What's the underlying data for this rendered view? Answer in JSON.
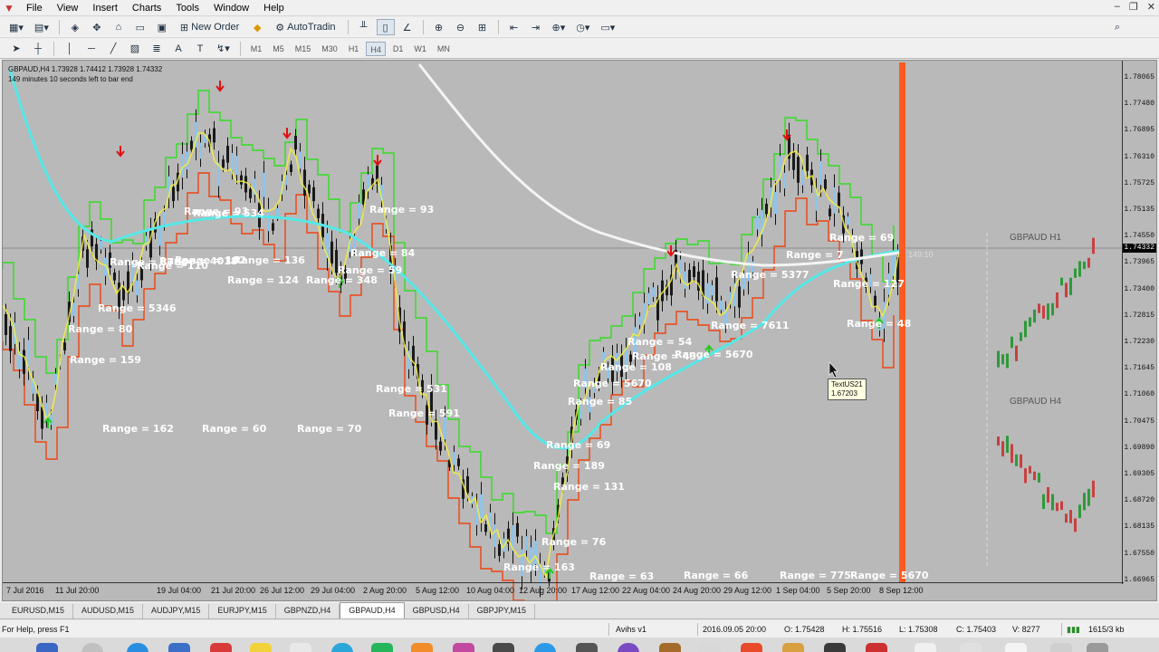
{
  "menu": {
    "items": [
      "File",
      "View",
      "Insert",
      "Charts",
      "Tools",
      "Window",
      "Help"
    ]
  },
  "toolbar": {
    "new_order": "New Order",
    "autotrading": "AutoTradin",
    "timeframes": [
      "M1",
      "M5",
      "M15",
      "M30",
      "H1",
      "H4",
      "D1",
      "W1",
      "MN"
    ],
    "active_timeframe": "H4"
  },
  "chart": {
    "header_line1": "GBPAUD,H4  1.73928 1.74412 1.73928 1.74332",
    "header_line2": "149 minutes 10 seconds left to bar end",
    "current_price": "1.74332",
    "price_ticks": [
      "1.78065",
      "1.77480",
      "1.76895",
      "1.76310",
      "1.75725",
      "1.75135",
      "1.74550",
      "1.73965",
      "1.73400",
      "1.72815",
      "1.72230",
      "1.71645",
      "1.71060",
      "1.70475",
      "1.69890",
      "1.69305",
      "1.68720",
      "1.68135",
      "1.67550",
      "1.66965"
    ],
    "time_ticks": [
      "7 Jul 2016",
      "11 Jul 20:00",
      "19 Jul 04:00",
      "21 Jul 20:00",
      "26 Jul 12:00",
      "29 Jul 04:00",
      "2 Aug 20:00",
      "5 Aug 12:00",
      "10 Aug 04:00",
      "12 Aug 20:00",
      "17 Aug 12:00",
      "22 Aug 04:00",
      "24 Aug 20:00",
      "29 Aug 12:00",
      "1 Sep 04:00",
      "5 Sep 20:00",
      "8 Sep 12:00"
    ],
    "countdown_label": "149:10",
    "tooltip_line1": "TextUS21",
    "tooltip_line2": "1.67203",
    "pane_h1": "GBPAUD H1",
    "pane_h4": "GBPAUD H4",
    "range_labels": [
      "Range = 159",
      "Range = 80",
      "Range = 5346",
      "Range = 8780",
      "Range = 110",
      "Range = 4018",
      "Range = 182",
      "Range = 93",
      "Range = 534",
      "Range = 136",
      "Range = 124",
      "Range = 348",
      "Range = 59",
      "Range = 84",
      "Range = 93",
      "Range = 162",
      "Range = 60",
      "Range = 70",
      "Range = 531",
      "Range = 591",
      "Range = 131",
      "Range = 189",
      "Range = 76",
      "Range = 163",
      "Range = 69",
      "Range = 85",
      "Range = 5670",
      "Range = 108",
      "Range = 43",
      "Range = 54",
      "Range = 5670",
      "Range = 7611",
      "Range = 5377",
      "Range = 7",
      "Range = 127",
      "Range = 48",
      "Range = 69",
      "Range = 63",
      "Range = 66",
      "Range = 775",
      "Range = 5670"
    ]
  },
  "tabs": {
    "items": [
      "EURUSD,M15",
      "AUDUSD,M15",
      "AUDJPY,M15",
      "EURJPY,M15",
      "GBPNZD,H4",
      "GBPAUD,H4",
      "GBPUSD,H4",
      "GBPJPY,M15"
    ],
    "active": "GBPAUD,H4"
  },
  "status": {
    "help": "For Help, press F1",
    "profile": "Avihs v1",
    "datetime": "2016.09.05 20:00",
    "open": "O: 1.75428",
    "high": "H: 1.75516",
    "low": "L: 1.75308",
    "close": "C: 1.75403",
    "volume": "V: 8277",
    "traffic": "1615/3 kb"
  },
  "colors": {
    "chart_bg": "#b9b9b9",
    "upper_channel": "#33dd22",
    "lower_channel": "#ee4411",
    "ma_cyan": "#55e8e8",
    "ma_white": "#f4f4f4",
    "vline": "#ff5a1f"
  }
}
